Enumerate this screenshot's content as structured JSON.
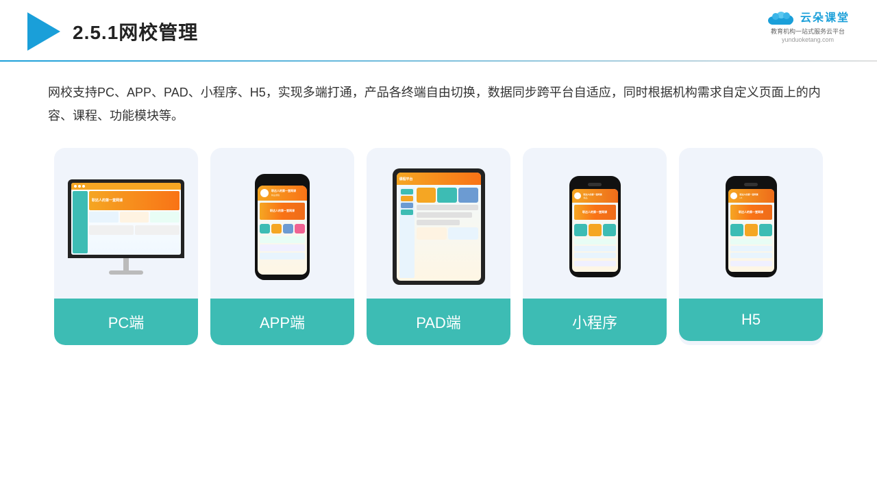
{
  "header": {
    "title": "2.5.1网校管理",
    "brand": {
      "name": "云朵课堂",
      "url": "yunduoketang.com",
      "tagline": "教育机构一站\n式服务云平台"
    }
  },
  "description": "网校支持PC、APP、PAD、小程序、H5，实现多端打通，产品各终端自由切换，数据同步跨平台自适应，同时根据机构需求自定义页面上的内容、课程、功能模块等。",
  "cards": [
    {
      "label": "PC端",
      "type": "pc"
    },
    {
      "label": "APP端",
      "type": "phone"
    },
    {
      "label": "PAD端",
      "type": "tablet"
    },
    {
      "label": "小程序",
      "type": "mini-phone"
    },
    {
      "label": "H5",
      "type": "mini-phone-h5"
    }
  ],
  "accent_color": "#3dbcb4"
}
